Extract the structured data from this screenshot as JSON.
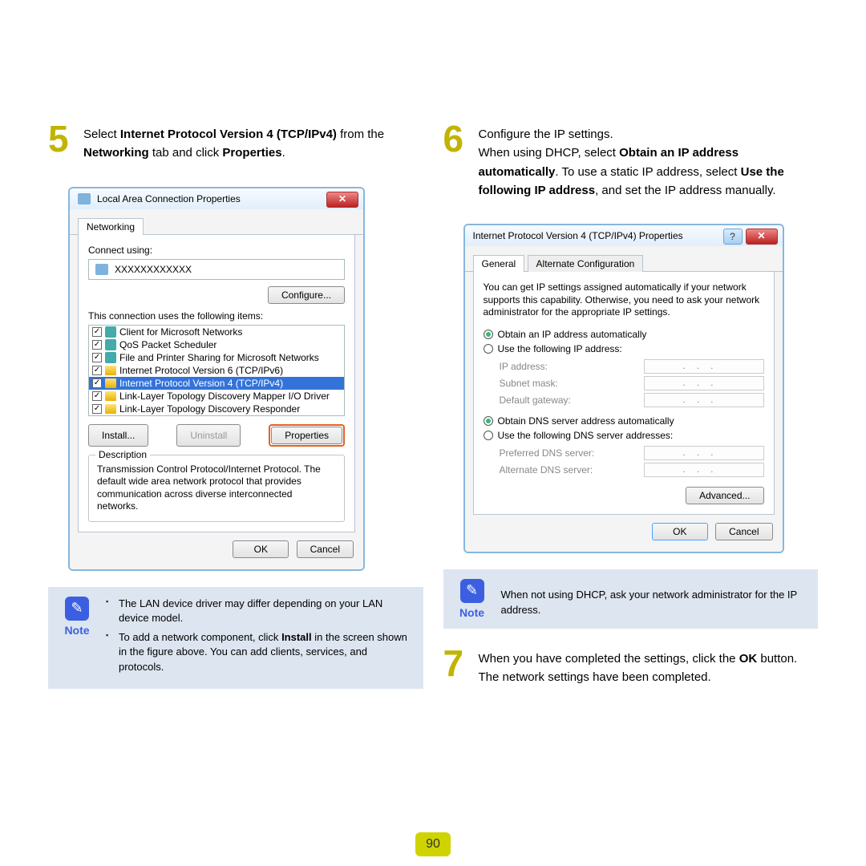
{
  "page_number": "90",
  "left": {
    "step_num": "5",
    "step_html_parts": [
      "Select ",
      "Internet Protocol Version 4 (TCP/IPv4)",
      " from the ",
      "Networking",
      " tab and click ",
      "Properties",
      "."
    ],
    "dialog": {
      "title": "Local Area Connection Properties",
      "tab": "Networking",
      "connect_using_label": "Connect using:",
      "adapter": "XXXXXXXXXXXX",
      "configure_btn": "Configure...",
      "items_label": "This connection uses the following items:",
      "items": [
        {
          "label": "Client for Microsoft Networks",
          "selected": false,
          "ico": "net"
        },
        {
          "label": "QoS Packet Scheduler",
          "selected": false,
          "ico": "net"
        },
        {
          "label": "File and Printer Sharing for Microsoft Networks",
          "selected": false,
          "ico": "net"
        },
        {
          "label": "Internet Protocol Version 6 (TCP/IPv6)",
          "selected": false,
          "ico": "proto"
        },
        {
          "label": "Internet Protocol Version 4 (TCP/IPv4)",
          "selected": true,
          "ico": "proto"
        },
        {
          "label": "Link-Layer Topology Discovery Mapper I/O Driver",
          "selected": false,
          "ico": "proto"
        },
        {
          "label": "Link-Layer Topology Discovery Responder",
          "selected": false,
          "ico": "proto"
        }
      ],
      "install_btn": "Install...",
      "uninstall_btn": "Uninstall",
      "properties_btn": "Properties",
      "desc_label": "Description",
      "desc_text": "Transmission Control Protocol/Internet Protocol. The default wide area network protocol that provides communication across diverse interconnected networks.",
      "ok": "OK",
      "cancel": "Cancel"
    },
    "note": {
      "label": "Note",
      "bullets": [
        "The LAN device driver may differ depending on your LAN device model.",
        "To add a network component, click Install in the screen shown in the figure above. You can add clients, services, and protocols."
      ]
    }
  },
  "right": {
    "step6_num": "6",
    "step6_html_parts": [
      "Configure the IP settings.",
      "When using DHCP, select ",
      "Obtain an IP address automatically",
      ". To use a static IP address, select ",
      "Use the following IP address",
      ", and set the IP address manually."
    ],
    "dialog": {
      "title": "Internet Protocol Version 4 (TCP/IPv4) Properties",
      "tab_general": "General",
      "tab_alt": "Alternate Configuration",
      "info": "You can get IP settings assigned automatically if your network supports this capability. Otherwise, you need to ask your network administrator for the appropriate IP settings.",
      "r_obtain_ip": "Obtain an IP address automatically",
      "r_use_ip": "Use the following IP address:",
      "ip_address": "IP address:",
      "subnet": "Subnet mask:",
      "gateway": "Default gateway:",
      "r_obtain_dns": "Obtain DNS server address automatically",
      "r_use_dns": "Use the following DNS server addresses:",
      "pref_dns": "Preferred DNS server:",
      "alt_dns": "Alternate DNS server:",
      "advanced": "Advanced...",
      "ok": "OK",
      "cancel": "Cancel"
    },
    "note": {
      "label": "Note",
      "text": "When not using DHCP, ask your network administrator for the IP address."
    },
    "step7_num": "7",
    "step7_text": "When you have completed the settings, click the OK button.",
    "step7_after": "The network settings have been completed."
  }
}
